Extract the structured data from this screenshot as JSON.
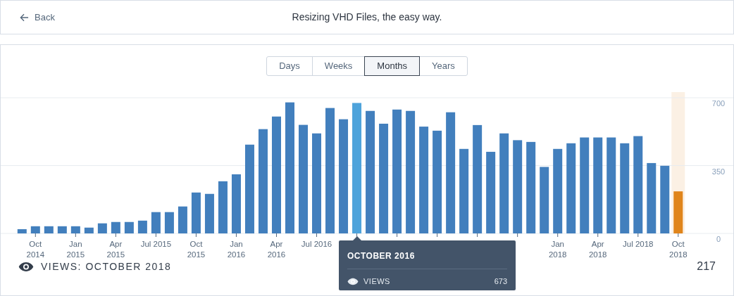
{
  "header": {
    "back_link": "Back",
    "title": "Resizing VHD Files, the easy way."
  },
  "range_tabs": [
    {
      "label": "Days",
      "selected": false
    },
    {
      "label": "Weeks",
      "selected": false
    },
    {
      "label": "Months",
      "selected": true
    },
    {
      "label": "Years",
      "selected": false
    }
  ],
  "chart": {
    "chart_data": {
      "type": "bar",
      "categories": [
        null,
        "Oct\n2014",
        null,
        null,
        "Jan\n2015",
        null,
        null,
        "Apr\n2015",
        null,
        null,
        "Jul 2015",
        null,
        null,
        "Oct\n2015",
        null,
        null,
        "Jan\n2016",
        null,
        null,
        "Apr\n2016",
        null,
        null,
        "Jul 2016",
        null,
        null,
        null,
        null,
        null,
        null,
        null,
        null,
        null,
        null,
        null,
        null,
        null,
        null,
        null,
        null,
        null,
        "Jan\n2018",
        null,
        null,
        "Apr\n2018",
        null,
        null,
        "Jul 2018",
        null,
        null,
        "Oct\n2018"
      ],
      "series": [
        {
          "color": "#427fbd",
          "values": [
            22,
            37,
            37,
            37,
            37,
            30,
            52,
            59,
            59,
            66,
            110,
            110,
            139,
            211,
            204,
            269,
            305,
            458,
            538,
            603,
            676,
            560,
            516,
            647,
            589,
            null,
            632,
            566,
            639,
            632,
            551,
            530,
            625,
            436,
            559,
            421,
            516,
            481,
            472,
            343,
            436,
            465,
            495,
            495,
            495,
            465,
            502,
            363,
            349,
            null
          ]
        },
        {
          "color": "#4ea3db",
          "values": [
            null,
            null,
            null,
            null,
            null,
            null,
            null,
            null,
            null,
            null,
            null,
            null,
            null,
            null,
            null,
            null,
            null,
            null,
            null,
            null,
            null,
            null,
            null,
            null,
            null,
            673,
            null,
            null,
            null,
            null,
            null,
            null,
            null,
            null,
            null,
            null,
            null,
            null,
            null,
            null,
            null,
            null,
            null,
            null,
            null,
            null,
            null,
            null,
            null,
            null
          ]
        },
        {
          "color": "#e0851b",
          "values": [
            null,
            null,
            null,
            null,
            null,
            null,
            null,
            null,
            null,
            null,
            null,
            null,
            null,
            null,
            null,
            null,
            null,
            null,
            null,
            null,
            null,
            null,
            null,
            null,
            null,
            null,
            null,
            null,
            null,
            null,
            null,
            null,
            null,
            null,
            null,
            null,
            null,
            null,
            null,
            null,
            null,
            null,
            null,
            null,
            null,
            null,
            null,
            null,
            null,
            217
          ]
        }
      ],
      "ylim": [
        0,
        700
      ],
      "yticks": [
        0,
        350,
        700
      ]
    },
    "current_month_band": {
      "color": "#fbf0e4"
    },
    "tooltip": {
      "title": "OCTOBER 2016",
      "label": "VIEWS",
      "value": "673"
    }
  },
  "footer": {
    "label": "VIEWS: OCTOBER 2018",
    "value": "217"
  }
}
